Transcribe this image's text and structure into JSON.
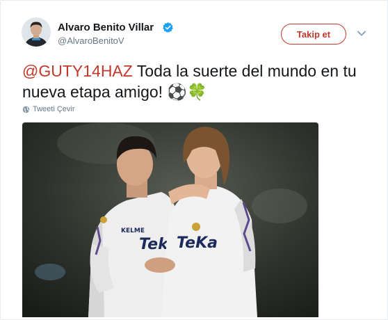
{
  "tweet": {
    "author_name": "Alvaro Benito Villar",
    "author_handle": "@AlvaroBenitoV",
    "follow_label": "Takip et",
    "mention": "@GUTY14HAZ",
    "text": " Toda la suerte del mundo en tu nueva etapa amigo! ⚽🍀",
    "translate_label": "Tweeti Çevir",
    "accent_color": "#c0392b",
    "verified_color": "#1da1f2"
  },
  "photo": {
    "jersey_sponsor_left": "KELME",
    "jersey_text_left": "Teka",
    "jersey_text_right": "TeKa"
  }
}
